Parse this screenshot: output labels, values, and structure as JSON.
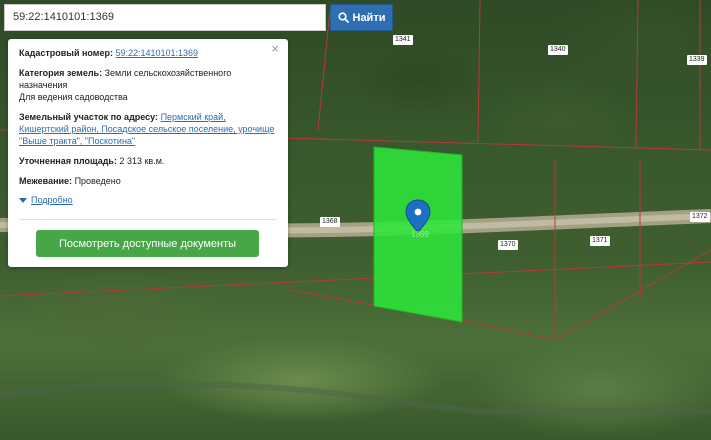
{
  "search": {
    "value": "59:22:1410101:1369",
    "button_label": "Найти"
  },
  "panel": {
    "close_glyph": "×",
    "cadastral_label": "Кадастровый номер:",
    "cadastral_value": "59:22:1410101:1369",
    "category_label": "Категория земель:",
    "category_value": "Земли сельскохозяйственного назначения",
    "usage_value": "Для ведения садоводства",
    "address_label": "Земельный участок по адресу:",
    "address_value": "Пермский край, Кишертский район, Посадское сельское поселение, урочище \"Выше тракта\", \"Поскотина\"",
    "area_label": "Уточненная площадь:",
    "area_value": "2 313 кв.м.",
    "survey_label": "Межевание:",
    "survey_value": "Проведено",
    "details_link": "Подробно",
    "docs_button": "Посмотреть доступные документы"
  },
  "map": {
    "parcel_labels": [
      "1341",
      "1340",
      "1339",
      "1368",
      "1370",
      "1371",
      "1372"
    ],
    "pin_label": "1369",
    "colors": {
      "highlight": "#2ee63a",
      "boundary": "#b53a36",
      "pin": "#1d6fc2"
    }
  }
}
